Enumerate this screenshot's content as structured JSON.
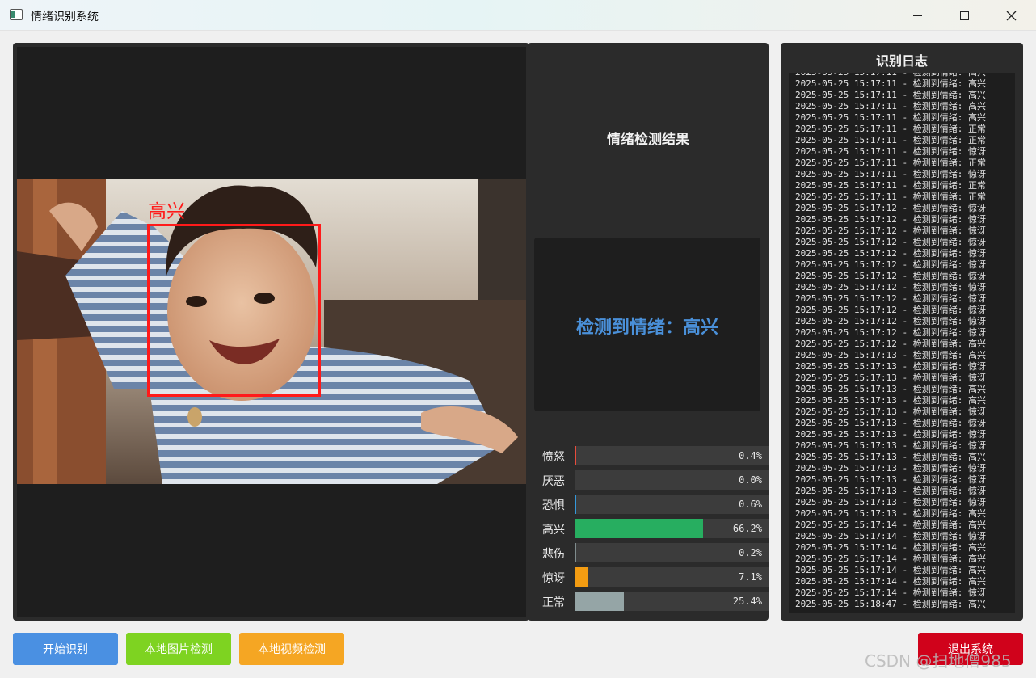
{
  "window": {
    "title": "情绪识别系统",
    "controls": [
      "minimize",
      "maximize",
      "close"
    ]
  },
  "video": {
    "face_label": "高兴",
    "box_color": "#ff1a1a"
  },
  "result": {
    "title": "情绪检测结果",
    "detected_text": "检测到情绪：高兴",
    "text_color": "#4a90d9"
  },
  "emotions": [
    {
      "label": "愤怒",
      "value": 0.4,
      "display": "0.4%",
      "color": "#e74c3c"
    },
    {
      "label": "厌恶",
      "value": 0.0,
      "display": "0.0%",
      "color": "#8e44ad"
    },
    {
      "label": "恐惧",
      "value": 0.6,
      "display": "0.6%",
      "color": "#3498db"
    },
    {
      "label": "高兴",
      "value": 66.2,
      "display": "66.2%",
      "color": "#27ae60"
    },
    {
      "label": "悲伤",
      "value": 0.2,
      "display": "0.2%",
      "color": "#7f8c8d"
    },
    {
      "label": "惊讶",
      "value": 7.1,
      "display": "7.1%",
      "color": "#f39c12"
    },
    {
      "label": "正常",
      "value": 25.4,
      "display": "25.4%",
      "color": "#95a5a6"
    }
  ],
  "log": {
    "title": "识别日志",
    "lines": [
      "2025-05-25 15:17:11 - 检测到情绪: 高兴",
      "2025-05-25 15:17:11 - 检测到情绪: 高兴",
      "2025-05-25 15:17:11 - 检测到情绪: 高兴",
      "2025-05-25 15:17:11 - 检测到情绪: 高兴",
      "2025-05-25 15:17:11 - 检测到情绪: 高兴",
      "2025-05-25 15:17:11 - 检测到情绪: 正常",
      "2025-05-25 15:17:11 - 检测到情绪: 正常",
      "2025-05-25 15:17:11 - 检测到情绪: 惊讶",
      "2025-05-25 15:17:11 - 检测到情绪: 正常",
      "2025-05-25 15:17:11 - 检测到情绪: 惊讶",
      "2025-05-25 15:17:11 - 检测到情绪: 正常",
      "2025-05-25 15:17:11 - 检测到情绪: 正常",
      "2025-05-25 15:17:12 - 检测到情绪: 惊讶",
      "2025-05-25 15:17:12 - 检测到情绪: 惊讶",
      "2025-05-25 15:17:12 - 检测到情绪: 惊讶",
      "2025-05-25 15:17:12 - 检测到情绪: 惊讶",
      "2025-05-25 15:17:12 - 检测到情绪: 惊讶",
      "2025-05-25 15:17:12 - 检测到情绪: 惊讶",
      "2025-05-25 15:17:12 - 检测到情绪: 惊讶",
      "2025-05-25 15:17:12 - 检测到情绪: 惊讶",
      "2025-05-25 15:17:12 - 检测到情绪: 惊讶",
      "2025-05-25 15:17:12 - 检测到情绪: 惊讶",
      "2025-05-25 15:17:12 - 检测到情绪: 惊讶",
      "2025-05-25 15:17:12 - 检测到情绪: 惊讶",
      "2025-05-25 15:17:12 - 检测到情绪: 高兴",
      "2025-05-25 15:17:13 - 检测到情绪: 高兴",
      "2025-05-25 15:17:13 - 检测到情绪: 惊讶",
      "2025-05-25 15:17:13 - 检测到情绪: 惊讶",
      "2025-05-25 15:17:13 - 检测到情绪: 高兴",
      "2025-05-25 15:17:13 - 检测到情绪: 高兴",
      "2025-05-25 15:17:13 - 检测到情绪: 惊讶",
      "2025-05-25 15:17:13 - 检测到情绪: 惊讶",
      "2025-05-25 15:17:13 - 检测到情绪: 惊讶",
      "2025-05-25 15:17:13 - 检测到情绪: 惊讶",
      "2025-05-25 15:17:13 - 检测到情绪: 高兴",
      "2025-05-25 15:17:13 - 检测到情绪: 惊讶",
      "2025-05-25 15:17:13 - 检测到情绪: 惊讶",
      "2025-05-25 15:17:13 - 检测到情绪: 惊讶",
      "2025-05-25 15:17:13 - 检测到情绪: 惊讶",
      "2025-05-25 15:17:13 - 检测到情绪: 高兴",
      "2025-05-25 15:17:14 - 检测到情绪: 高兴",
      "2025-05-25 15:17:14 - 检测到情绪: 惊讶",
      "2025-05-25 15:17:14 - 检测到情绪: 高兴",
      "2025-05-25 15:17:14 - 检测到情绪: 高兴",
      "2025-05-25 15:17:14 - 检测到情绪: 高兴",
      "2025-05-25 15:17:14 - 检测到情绪: 高兴",
      "2025-05-25 15:17:14 - 检测到情绪: 惊讶",
      "2025-05-25 15:18:47 - 检测到情绪: 高兴"
    ]
  },
  "buttons": {
    "start": "开始识别",
    "image": "本地图片检测",
    "video": "本地视频检测",
    "exit": "退出系统"
  },
  "watermark": "CSDN @扫地僧985"
}
